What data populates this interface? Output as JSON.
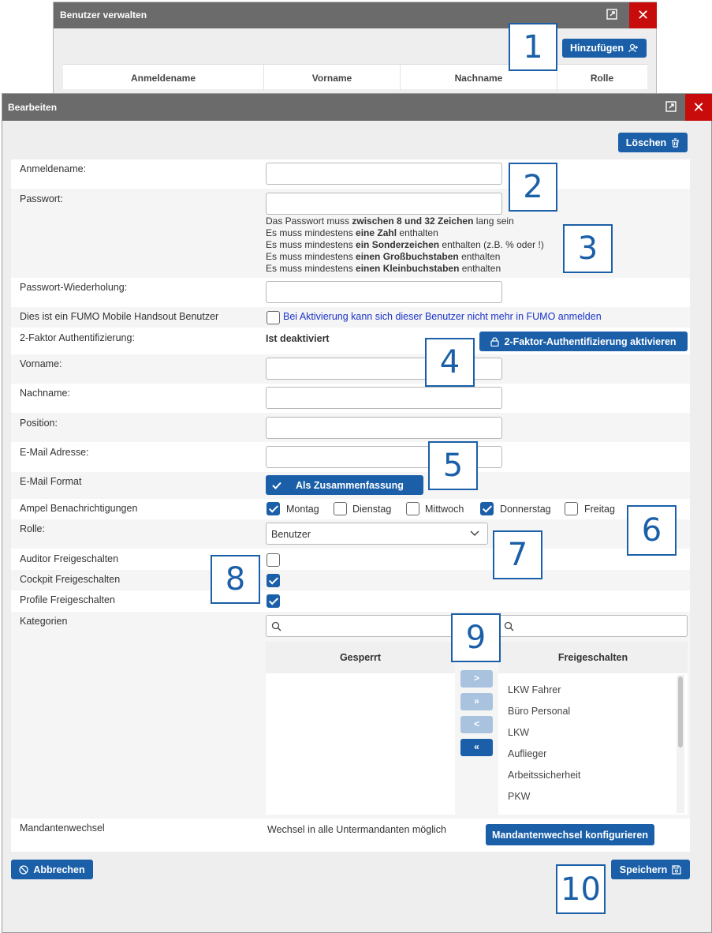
{
  "back_window": {
    "title": "Benutzer verwalten",
    "add_button": "Hinzufügen",
    "columns": [
      "Anmeldename",
      "Vorname",
      "Nachname",
      "Rolle"
    ]
  },
  "dialog": {
    "title": "Bearbeiten",
    "delete_button": "Löschen",
    "fields": {
      "username_label": "Anmeldename:",
      "password_label": "Passwort:",
      "password_hints": [
        [
          "Das Passwort muss ",
          "zwischen 8 und 32 Zeichen",
          " lang sein"
        ],
        [
          "Es muss mindestens ",
          "eine Zahl",
          " enthalten"
        ],
        [
          "Es muss mindestens ",
          "ein Sonderzeichen",
          " enthalten (z.B. % oder !)"
        ],
        [
          "Es muss mindestens ",
          "einen Großbuchstaben",
          " enthalten"
        ],
        [
          "Es muss mindestens ",
          "einen Kleinbuchstaben",
          " enthalten"
        ]
      ],
      "password_repeat_label": "Passwort-Wiederholung:",
      "mobile_label": "Dies ist ein FUMO Mobile Handsout Benutzer",
      "mobile_hint": "Bei Aktivierung kann sich dieser Benutzer nicht mehr in FUMO anmelden",
      "twofa_label": "2-Faktor Authentifizierung:",
      "twofa_status": "Ist deaktiviert",
      "twofa_button": "2-Faktor-Authentifizierung aktivieren",
      "firstname_label": "Vorname:",
      "lastname_label": "Nachname:",
      "position_label": "Position:",
      "email_label": "E-Mail Adresse:",
      "email_format_label": "E-Mail Format",
      "email_format_value": "Als Zusammenfassung",
      "traffic_label": "Ampel Benachrichtigungen",
      "days": [
        {
          "label": "Montag",
          "checked": true
        },
        {
          "label": "Dienstag",
          "checked": false
        },
        {
          "label": "Mittwoch",
          "checked": false
        },
        {
          "label": "Donnerstag",
          "checked": true
        },
        {
          "label": "Freitag",
          "checked": false
        }
      ],
      "role_label": "Rolle:",
      "role_value": "Benutzer",
      "auditor_label": "Auditor Freigeschalten",
      "auditor_checked": false,
      "cockpit_label": "Cockpit Freigeschalten",
      "cockpit_checked": true,
      "profile_label": "Profile Freigeschalten",
      "profile_checked": true,
      "categories_label": "Kategorien",
      "blocked_header": "Gesperrt",
      "unlocked_header": "Freigeschalten",
      "unlocked_items": [
        "LKW Fahrer",
        "Büro Personal",
        "LKW",
        "Auflieger",
        "Arbeitssicherheit",
        "PKW"
      ],
      "move_buttons": [
        ">",
        "»",
        "<",
        "«"
      ],
      "client_switch_label": "Mandantenwechsel",
      "client_switch_value": "Wechsel in alle Untermandanten möglich",
      "client_switch_button": "Mandantenwechsel konfigurieren"
    },
    "cancel_button": "Abbrechen",
    "save_button": "Speichern"
  },
  "callouts": [
    "1",
    "2",
    "3",
    "4",
    "5",
    "6",
    "7",
    "8",
    "9",
    "10"
  ],
  "colors": {
    "accent": "#1a5fa8",
    "close": "#c80c0c",
    "titlebar": "#6b6b6b"
  }
}
